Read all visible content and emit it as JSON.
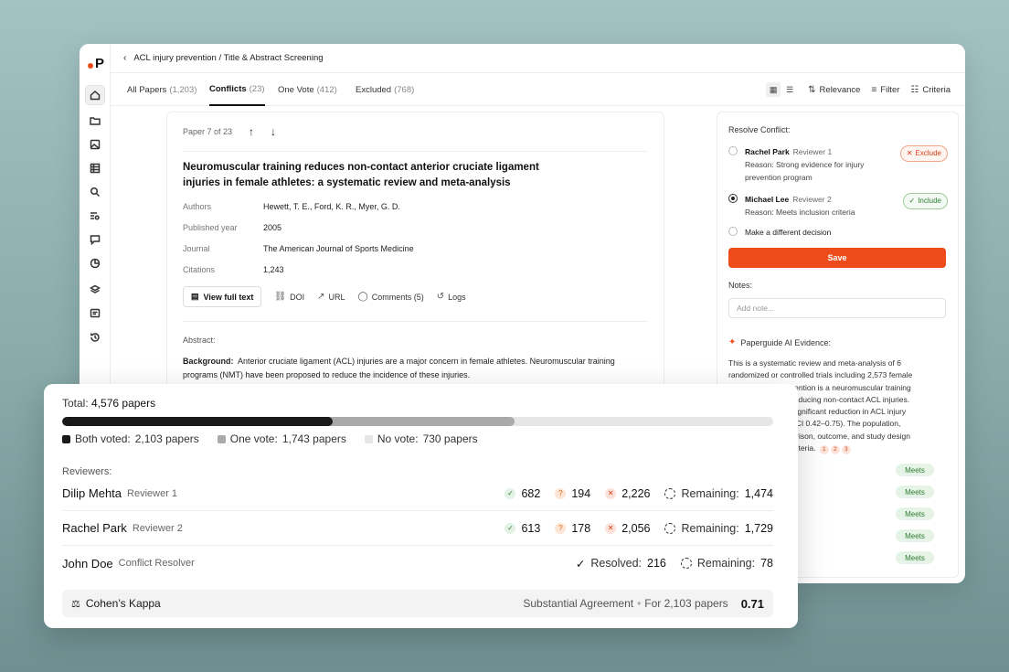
{
  "app": {
    "logo_letter": "P",
    "breadcrumb": "ACL injury prevention / Title & Abstract Screening",
    "accent_color": "#ee4d1b"
  },
  "rail_icons": [
    "home-icon",
    "folder-icon",
    "image-icon",
    "table-icon",
    "search-icon",
    "list-search-icon",
    "chat-icon",
    "chart-icon",
    "layers-icon",
    "message-icon",
    "history-icon"
  ],
  "tabs": [
    {
      "label": "All Papers",
      "count": "(1,203)"
    },
    {
      "label": "Conflicts",
      "count": "(23)"
    },
    {
      "label": "One Vote",
      "count": "(412)"
    },
    {
      "label": "Excluded",
      "count": "(768)"
    }
  ],
  "tools": {
    "relevance": "Relevance",
    "filter": "Filter",
    "criteria": "Criteria"
  },
  "paper": {
    "position": "Paper 7 of 23",
    "title": "Neuromuscular training reduces non-contact anterior cruciate ligament injuries in female athletes: a systematic review and meta-analysis",
    "meta": [
      {
        "k": "Authors",
        "v": "Hewett, T. E., Ford, K. R., Myer, G. D."
      },
      {
        "k": "Published year",
        "v": "2005"
      },
      {
        "k": "Journal",
        "v": "The American Journal of Sports Medicine"
      },
      {
        "k": "Citations",
        "v": "1,243"
      }
    ],
    "actions": {
      "full_text": "View full text",
      "doi": "DOI",
      "url": "URL",
      "comments": "Comments (5)",
      "logs": "Logs"
    },
    "abstract_label": "Abstract:",
    "abstract_head": "Background:",
    "abstract_body": "Anterior cruciate ligament (ACL) injuries are a major concern in female athletes. Neuromuscular training programs (NMT) have been proposed to reduce the incidence of these injuries."
  },
  "resolve": {
    "label": "Resolve Conflict:",
    "options": [
      {
        "name": "Rachel Park",
        "role": "Reviewer 1",
        "reason": "Reason: Strong evidence for injury prevention program",
        "badge": "Exclude"
      },
      {
        "name": "Michael Lee",
        "role": "Reviewer 2",
        "reason": "Reason: Meets inclusion criteria",
        "badge": "Include"
      },
      {
        "name": "Make a different decision"
      }
    ],
    "save": "Save",
    "notes_label": "Notes:",
    "notes_placeholder": "Add note...",
    "ai_label": "Paperguide AI Evidence:",
    "ai_lines": [
      "This is a systematic review and meta-analysis of 6",
      "randomized or controlled trials including 2,573 female",
      "athletes. The intervention is a neuromuscular training",
      "program aimed at reducing non-contact ACL injuries.",
      "NMT resulted in a significant reduction in ACL injury",
      "risk (RR 0.50, 95% CI 0.42–0.75). The population,",
      "intervention, comparison, outcome, and study design",
      "meet all inclusion criteria."
    ],
    "citations": [
      "1",
      "2",
      "3"
    ],
    "meets_label": "Meets"
  },
  "stats": {
    "total_label": "Total:",
    "total_value": "4,576 papers",
    "progress": {
      "both_pct": 38.0,
      "one_pct": 63.6
    },
    "colors": {
      "both": "#1a1a1a",
      "one": "#a9a9a9",
      "none": "#e6e6e6"
    },
    "legend": [
      {
        "label": "Both voted:",
        "value": "2,103 papers"
      },
      {
        "label": "One vote:",
        "value": "1,743 papers"
      },
      {
        "label": "No vote:",
        "value": "730 papers"
      }
    ],
    "reviewers_label": "Reviewers:",
    "reviewers": [
      {
        "name": "Dilip Mehta",
        "role": "Reviewer 1",
        "include": "682",
        "maybe": "194",
        "exclude": "2,226",
        "remaining_label": "Remaining:",
        "remaining": "1,474"
      },
      {
        "name": "Rachel Park",
        "role": "Reviewer 2",
        "include": "613",
        "maybe": "178",
        "exclude": "2,056",
        "remaining_label": "Remaining:",
        "remaining": "1,729"
      }
    ],
    "resolver": {
      "name": "John Doe",
      "role": "Conflict Resolver",
      "resolved_label": "Resolved:",
      "resolved": "216",
      "remaining_label": "Remaining:",
      "remaining": "78"
    },
    "kappa": {
      "label": "Cohen’s Kappa",
      "agreement": "Substantial Agreement",
      "basis": "For 2,103 papers",
      "value": "0.71"
    }
  }
}
